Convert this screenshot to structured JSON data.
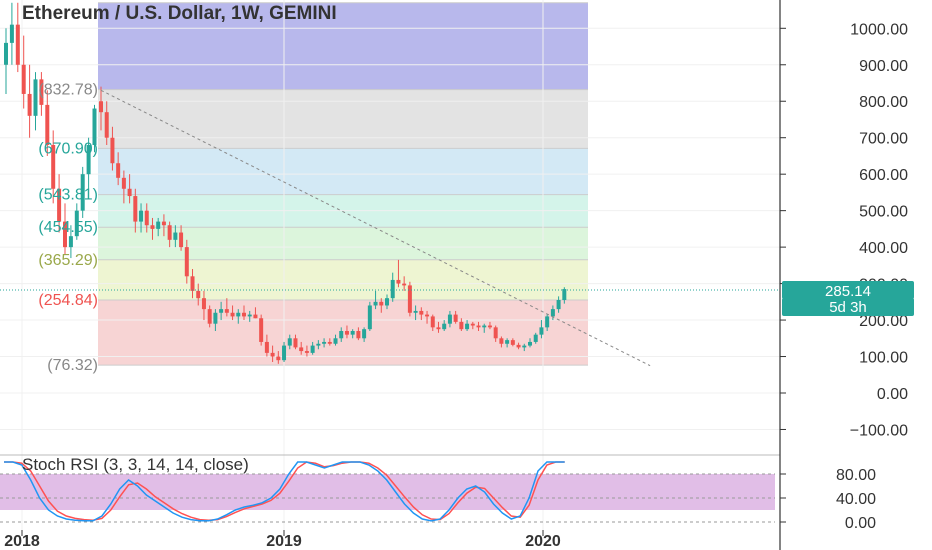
{
  "chart_data": [
    {
      "type": "candlestick",
      "title": "Ethereum / U.S. Dollar, 1W, GEMINI",
      "ylim": [
        -180,
        1070
      ],
      "y_ticks": [
        "1000.00",
        "900.00",
        "800.00",
        "700.00",
        "600.00",
        "500.00",
        "400.00",
        "300.00",
        "200.00",
        "100.00",
        "0.00",
        "−100.00"
      ],
      "y_tick_values": [
        1000,
        900,
        800,
        700,
        600,
        500,
        400,
        300,
        200,
        100,
        0,
        -100
      ],
      "x_labels": [
        "2018",
        "2019",
        "2020"
      ],
      "last_price": "285.14",
      "countdown": "5d 3h",
      "colors": {
        "up": "#26a69a",
        "down": "#ef5350",
        "last_price_bg": "#26a69a"
      },
      "fib_levels": [
        {
          "price": 1070,
          "color": "#b8b8ec",
          "label": ""
        },
        {
          "price": 832,
          "color": "#e3e3e3",
          "label": "832.78"
        },
        {
          "price": 670.9,
          "color": "#d3e9f5",
          "label": "670.90"
        },
        {
          "price": 543.81,
          "color": "#d4f4ea",
          "label": "543.81"
        },
        {
          "price": 454.55,
          "color": "#dcf5dc",
          "label": "454.55"
        },
        {
          "price": 365.29,
          "color": "#eef5d2",
          "label": "365.29"
        },
        {
          "price": 254.84,
          "color": "#f7d4d4",
          "label": "254.84"
        },
        {
          "price": 76.32,
          "color": "#f7d4d4",
          "label": "76.32"
        }
      ],
      "fib_label_colors": [
        "#888888",
        "#888888",
        "#26a69a",
        "#26a69a",
        "#26a69a",
        "#9aa84a",
        "#ef5350",
        "#888888"
      ],
      "trend_line": {
        "from": {
          "week": 0,
          "price": 830
        },
        "to": {
          "week": 96,
          "price": 75
        }
      },
      "x_weeks_origin": "2018-04-01",
      "candles": [
        [
          800,
          840,
          720,
          770
        ],
        [
          770,
          800,
          680,
          700
        ],
        [
          700,
          730,
          610,
          630
        ],
        [
          630,
          660,
          570,
          590
        ],
        [
          590,
          610,
          520,
          560
        ],
        [
          560,
          600,
          520,
          540
        ],
        [
          540,
          560,
          440,
          470
        ],
        [
          470,
          520,
          440,
          500
        ],
        [
          500,
          520,
          440,
          460
        ],
        [
          460,
          480,
          420,
          450
        ],
        [
          450,
          480,
          430,
          470
        ],
        [
          470,
          490,
          430,
          460
        ],
        [
          460,
          470,
          400,
          420
        ],
        [
          420,
          460,
          400,
          440
        ],
        [
          440,
          460,
          390,
          400
        ],
        [
          400,
          420,
          300,
          320
        ],
        [
          320,
          340,
          260,
          280
        ],
        [
          280,
          300,
          240,
          260
        ],
        [
          260,
          280,
          200,
          230
        ],
        [
          230,
          240,
          180,
          190
        ],
        [
          190,
          230,
          170,
          220
        ],
        [
          220,
          250,
          200,
          230
        ],
        [
          230,
          260,
          210,
          220
        ],
        [
          220,
          240,
          200,
          210
        ],
        [
          210,
          230,
          190,
          220
        ],
        [
          220,
          240,
          200,
          210
        ],
        [
          210,
          225,
          195,
          215
        ],
        [
          215,
          235,
          205,
          205
        ],
        [
          205,
          215,
          130,
          140
        ],
        [
          140,
          160,
          100,
          110
        ],
        [
          110,
          130,
          85,
          100
        ],
        [
          100,
          115,
          80,
          90
        ],
        [
          90,
          140,
          85,
          130
        ],
        [
          130,
          160,
          120,
          150
        ],
        [
          150,
          160,
          120,
          125
        ],
        [
          125,
          140,
          105,
          115
        ],
        [
          115,
          130,
          100,
          110
        ],
        [
          110,
          140,
          105,
          130
        ],
        [
          130,
          145,
          120,
          135
        ],
        [
          135,
          150,
          125,
          140
        ],
        [
          140,
          150,
          130,
          135
        ],
        [
          135,
          160,
          130,
          150
        ],
        [
          150,
          180,
          140,
          170
        ],
        [
          170,
          185,
          150,
          160
        ],
        [
          160,
          175,
          150,
          170
        ],
        [
          170,
          180,
          145,
          150
        ],
        [
          150,
          180,
          140,
          175
        ],
        [
          175,
          250,
          170,
          240
        ],
        [
          240,
          280,
          230,
          250
        ],
        [
          250,
          260,
          220,
          240
        ],
        [
          240,
          270,
          230,
          260
        ],
        [
          260,
          330,
          250,
          310
        ],
        [
          310,
          365,
          290,
          300
        ],
        [
          300,
          320,
          280,
          295
        ],
        [
          295,
          305,
          210,
          220
        ],
        [
          220,
          240,
          200,
          225
        ],
        [
          225,
          235,
          200,
          215
        ],
        [
          215,
          225,
          190,
          210
        ],
        [
          210,
          215,
          170,
          180
        ],
        [
          180,
          195,
          165,
          175
        ],
        [
          175,
          200,
          170,
          190
        ],
        [
          190,
          225,
          180,
          215
        ],
        [
          215,
          225,
          190,
          195
        ],
        [
          195,
          205,
          170,
          175
        ],
        [
          175,
          200,
          170,
          190
        ],
        [
          190,
          195,
          175,
          185
        ],
        [
          185,
          195,
          170,
          180
        ],
        [
          180,
          190,
          165,
          185
        ],
        [
          185,
          195,
          175,
          180
        ],
        [
          180,
          185,
          140,
          150
        ],
        [
          150,
          155,
          125,
          135
        ],
        [
          135,
          150,
          125,
          145
        ],
        [
          145,
          150,
          128,
          132
        ],
        [
          132,
          138,
          120,
          125
        ],
        [
          125,
          135,
          115,
          130
        ],
        [
          130,
          150,
          125,
          140
        ],
        [
          140,
          165,
          135,
          160
        ],
        [
          160,
          200,
          150,
          180
        ],
        [
          180,
          215,
          170,
          210
        ],
        [
          210,
          240,
          200,
          230
        ],
        [
          230,
          265,
          220,
          255
        ],
        [
          255,
          290,
          245,
          285
        ]
      ]
    },
    {
      "type": "line",
      "title": "Stoch RSI (3, 3, 14, 14, close)",
      "ylim": [
        -5,
        100
      ],
      "y_ticks": [
        "80.00",
        "40.00",
        "0.00"
      ],
      "y_tick_values": [
        80,
        40,
        0
      ],
      "band": [
        20,
        80
      ],
      "colors": {
        "k": "#2196f3",
        "d": "#ff5252",
        "band": "#e1bee7"
      },
      "series": [
        {
          "values": [
            100,
            100,
            95,
            70,
            40,
            20,
            10,
            5,
            3,
            2,
            2,
            10,
            30,
            55,
            70,
            60,
            45,
            35,
            25,
            15,
            8,
            4,
            2,
            2,
            5,
            12,
            20,
            25,
            28,
            32,
            40,
            55,
            80,
            100,
            100,
            95,
            90,
            95,
            100,
            100,
            100,
            95,
            85,
            70,
            50,
            30,
            15,
            5,
            2,
            5,
            20,
            40,
            55,
            60,
            50,
            30,
            15,
            5,
            10,
            40,
            85,
            100,
            100,
            100
          ]
        },
        {
          "values": [
            100,
            100,
            98,
            85,
            60,
            35,
            18,
            10,
            6,
            4,
            3,
            6,
            20,
            42,
            62,
            65,
            55,
            42,
            32,
            22,
            14,
            8,
            4,
            3,
            4,
            9,
            16,
            22,
            26,
            30,
            36,
            48,
            68,
            90,
            100,
            98,
            92,
            94,
            98,
            100,
            100,
            98,
            90,
            78,
            60,
            42,
            25,
            12,
            5,
            4,
            14,
            32,
            48,
            58,
            56,
            40,
            24,
            10,
            8,
            28,
            70,
            95,
            100,
            100
          ]
        }
      ]
    }
  ]
}
